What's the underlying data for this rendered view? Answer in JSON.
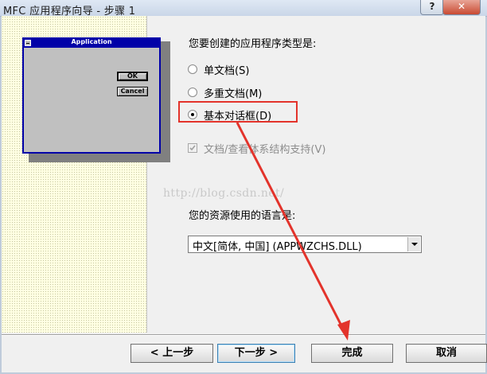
{
  "window": {
    "title": "MFC 应用程序向导 - 步骤 1",
    "help_label": "?",
    "close_label": "✕"
  },
  "preview": {
    "title": "Application",
    "ok_label": "OK",
    "cancel_label": "Cancel"
  },
  "app_type": {
    "question": "您要创建的应用程序类型是:",
    "options": [
      {
        "label": "单文档(S)",
        "checked": false
      },
      {
        "label": "多重文档(M)",
        "checked": false
      },
      {
        "label": "基本对话框(D)",
        "checked": true
      }
    ],
    "doc_view_label": "文档/查看体系结构支持(V)",
    "doc_view_checked": true,
    "doc_view_enabled": false
  },
  "watermark": "http://blog.csdn.net/",
  "language": {
    "label": "您的资源使用的语言是:",
    "selected": "中文[简体, 中国] (APPWZCHS.DLL)"
  },
  "buttons": {
    "back": "< 上一步",
    "next": "下一步 >",
    "finish": "完成",
    "cancel": "取消"
  },
  "annotation": {
    "highlight_color": "#e3332b",
    "arrow_color": "#e3332b"
  }
}
